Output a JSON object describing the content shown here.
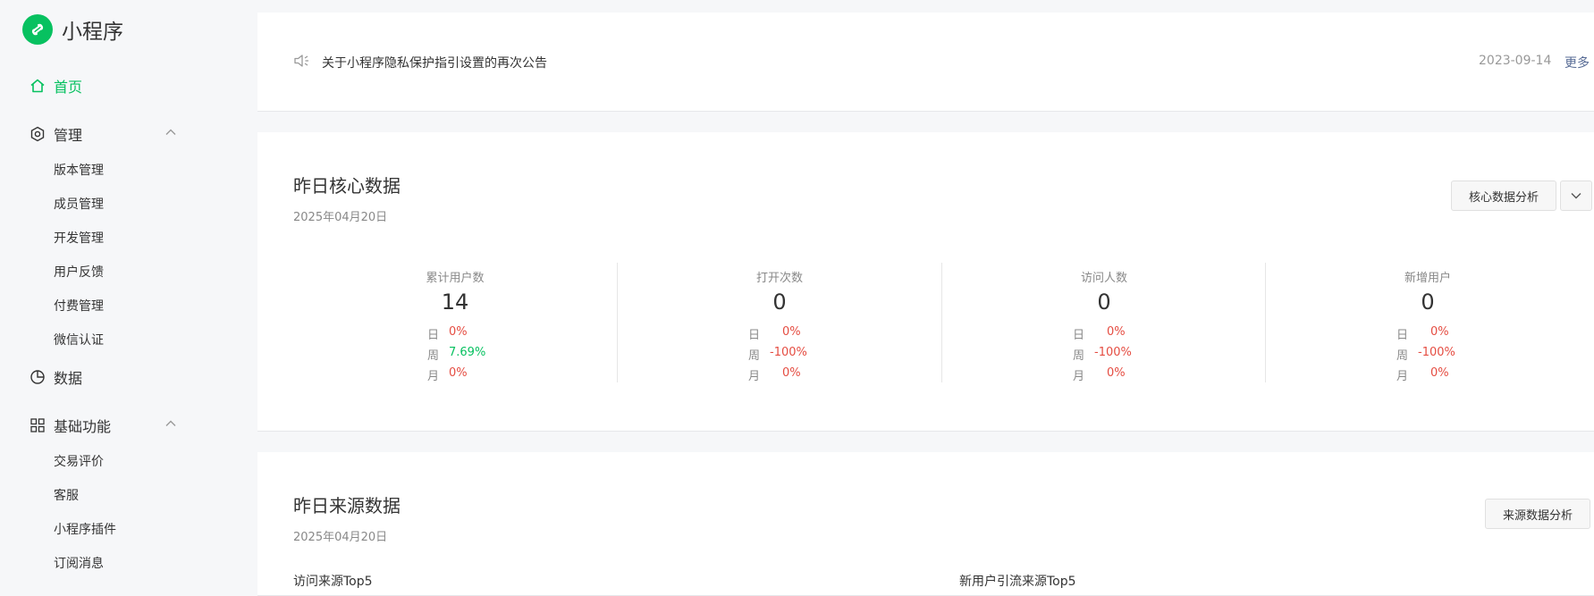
{
  "brand": {
    "name": "小程序"
  },
  "nav": {
    "home": "首页",
    "manage": {
      "label": "管理",
      "items": [
        "版本管理",
        "成员管理",
        "开发管理",
        "用户反馈",
        "付费管理",
        "微信认证"
      ]
    },
    "data": "数据",
    "basic": {
      "label": "基础功能",
      "items": [
        "交易评价",
        "客服",
        "小程序插件",
        "订阅消息"
      ]
    }
  },
  "notice": {
    "text": "关于小程序隐私保护指引设置的再次公告",
    "date": "2023-09-14",
    "more": "更多"
  },
  "core": {
    "title": "昨日核心数据",
    "date": "2025年04月20日",
    "button": "核心数据分析",
    "metrics": [
      {
        "label": "累计用户数",
        "value": "14",
        "day": "0%",
        "week": "7.69%",
        "month": "0%"
      },
      {
        "label": "打开次数",
        "value": "0",
        "day": "0%",
        "week": "-100%",
        "month": "0%"
      },
      {
        "label": "访问人数",
        "value": "0",
        "day": "0%",
        "week": "-100%",
        "month": "0%"
      },
      {
        "label": "新增用户",
        "value": "0",
        "day": "0%",
        "week": "-100%",
        "month": "0%"
      }
    ],
    "row_labels": {
      "day": "日",
      "week": "周",
      "month": "月"
    }
  },
  "source": {
    "title": "昨日来源数据",
    "date": "2025年04月20日",
    "button": "来源数据分析",
    "left_head": "访问来源Top5",
    "right_head": "新用户引流来源Top5"
  },
  "colors": {
    "accent": "#07c160",
    "negative": "#e54d42",
    "link": "#576b95"
  }
}
